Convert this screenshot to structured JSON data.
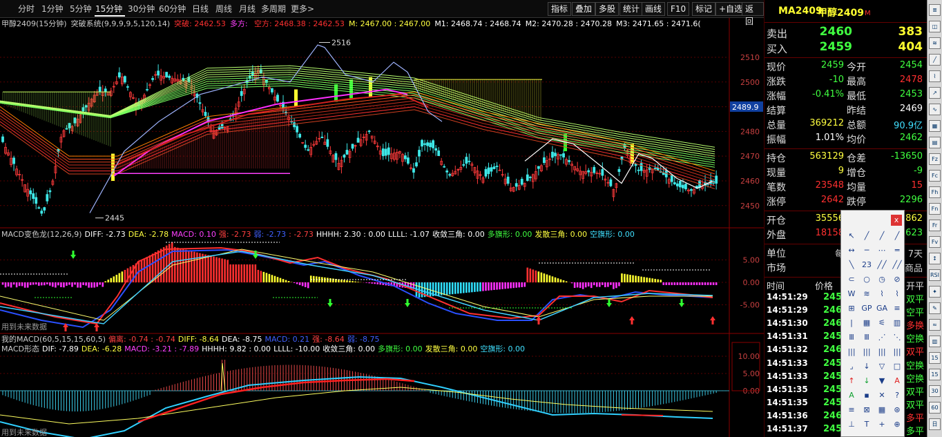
{
  "toolbar": {
    "periods": [
      "分时",
      "1分钟",
      "5分钟",
      "15分钟",
      "30分钟",
      "60分钟",
      "日线",
      "周线",
      "月线",
      "多周期",
      "更多>"
    ],
    "active_period": "15分钟",
    "right_buttons": [
      "指标",
      "叠加",
      "多股",
      "统计",
      "画线",
      "F10",
      "标记",
      "+自选",
      "返回"
    ]
  },
  "main_legend": {
    "symbol": "甲醇2409(15分钟)",
    "indicator": "突破系统(9,9,9,9,5,120,14)",
    "items": [
      {
        "text": "突破: 2462.53",
        "color": "#ff3030"
      },
      {
        "text": "多方: ",
        "color": "#ff40ff"
      },
      {
        "text": "空方: 2468.38 : 2462.53",
        "color": "#ff3030"
      },
      {
        "text": "M: 2467.00 : 2467.00",
        "color": "#ffff40"
      },
      {
        "text": "M1: 2468.74 : 2468.74",
        "color": "#ffffff"
      },
      {
        "text": "M2: 2470.28 : 2470.28",
        "color": "#ffffff"
      },
      {
        "text": "M3: 2471.65 : 2471.6(",
        "color": "#ffffff"
      }
    ]
  },
  "price_axis": [
    "2510",
    "2500",
    "2490",
    "2480",
    "2470",
    "2460",
    "2450"
  ],
  "current_price_tag": "2489.9",
  "annotations": {
    "high": "2516",
    "low": "2445"
  },
  "macd1": {
    "legend": "MACD变色龙(12,26,9)",
    "items": [
      {
        "text": "DIFF: -2.73",
        "color": "#ffffff"
      },
      {
        "text": "DEA: -2.78",
        "color": "#ffff40"
      },
      {
        "text": "MACD: 0.10",
        "color": "#ff40ff"
      },
      {
        "text": "强: -2.73",
        "color": "#ff4040"
      },
      {
        "text": "弱: -2.73",
        "color": "#4060ff"
      },
      {
        "text": ": -2.73",
        "color": "#ff4040"
      },
      {
        "text": "HHHH: 2.30 : 0.00",
        "color": "#ffffff"
      },
      {
        "text": "LLLL: -1.07",
        "color": "#ffffff"
      },
      {
        "text": "收敛三角: 0.00",
        "color": "#ffffff"
      },
      {
        "text": "多旗形: 0.00",
        "color": "#40ff40"
      },
      {
        "text": "发散三角: 0.00",
        "color": "#ffff40"
      },
      {
        "text": "空旗形: 0.00",
        "color": "#40e0ff"
      }
    ],
    "axis": [
      "5.00",
      "0.00",
      "-5.00"
    ]
  },
  "macd2": {
    "legend1": "我的MACD(60,5,15,15,60,5)",
    "items1": [
      {
        "text": "偏离: -0.74 : -0.74",
        "color": "#ff4040"
      },
      {
        "text": "DIFF: -8.64",
        "color": "#ffff40"
      },
      {
        "text": "DEA: -8.75",
        "color": "#ffffff"
      },
      {
        "text": "MACD: 0.21",
        "color": "#4060ff"
      },
      {
        "text": "强: -8.64",
        "color": "#ff4040"
      },
      {
        "text": "弱: -8.75",
        "color": "#4060ff"
      }
    ],
    "legend2": "MACD形态",
    "items2": [
      {
        "text": "DIF: -7.89",
        "color": "#ffffff"
      },
      {
        "text": "DEA: -6.28",
        "color": "#ffff40"
      },
      {
        "text": "MACD: -3.21 : -7.89",
        "color": "#ff40ff"
      },
      {
        "text": "HHHH: 9.82 : 0.00",
        "color": "#ffffff"
      },
      {
        "text": "LLLL: -10.00",
        "color": "#ffffff"
      },
      {
        "text": "收敛三角: 0.00",
        "color": "#ffffff"
      },
      {
        "text": "多旗形: 0.00",
        "color": "#40ff40"
      },
      {
        "text": "发散三角: 0.00",
        "color": "#ffff40"
      },
      {
        "text": "空旗形: 0.00",
        "color": "#40e0ff"
      }
    ],
    "axis": [
      "10.00",
      "5.00",
      "0.00"
    ]
  },
  "future_label": "用到未来数据",
  "quote": {
    "code": "MA2409",
    "name": "甲醇2409",
    "flag": "M",
    "sell": {
      "label": "卖出",
      "price": "2460",
      "vol": "383"
    },
    "buy": {
      "label": "买入",
      "price": "2459",
      "vol": "404"
    },
    "rows": [
      [
        {
          "l": "现价",
          "v": "2459",
          "c": "#40ff40"
        },
        {
          "l": "今开",
          "v": "2454",
          "c": "#40ff40"
        }
      ],
      [
        {
          "l": "涨跌",
          "v": "-10",
          "c": "#40ff40"
        },
        {
          "l": "最高",
          "v": "2478",
          "c": "#ff3030"
        }
      ],
      [
        {
          "l": "涨幅",
          "v": "-0.41%",
          "c": "#40ff40"
        },
        {
          "l": "最低",
          "v": "2453",
          "c": "#40ff40"
        }
      ],
      [
        {
          "l": "结算",
          "v": "",
          "c": "#fff"
        },
        {
          "l": "昨结",
          "v": "2469",
          "c": "#ffffff"
        }
      ],
      [
        {
          "l": "总量",
          "v": "369212",
          "c": "#ffff40"
        },
        {
          "l": "总额",
          "v": "90.9亿",
          "c": "#40e0ff"
        }
      ],
      [
        {
          "l": "振幅",
          "v": "1.01%",
          "c": "#ffffff"
        },
        {
          "l": "均价",
          "v": "2462",
          "c": "#40ff40"
        }
      ],
      [
        {
          "l": "持仓",
          "v": "563129",
          "c": "#ffff40"
        },
        {
          "l": "仓差",
          "v": "-13650",
          "c": "#40ff40"
        }
      ],
      [
        {
          "l": "现量",
          "v": "9",
          "c": "#ffff40"
        },
        {
          "l": "增仓",
          "v": "-9",
          "c": "#40ff40"
        }
      ],
      [
        {
          "l": "笔数",
          "v": "23548",
          "c": "#ff3030"
        },
        {
          "l": "均量",
          "v": "15",
          "c": "#ff3030"
        }
      ],
      [
        {
          "l": "涨停",
          "v": "2642",
          "c": "#ff3030"
        },
        {
          "l": "跌停",
          "v": "2296",
          "c": "#40ff40"
        }
      ],
      [
        {
          "l": "开仓",
          "v": "35556",
          "c": "#ffff40"
        },
        {
          "l": "",
          "v": "2862",
          "c": "#ffff40"
        }
      ],
      [
        {
          "l": "外盘",
          "v": "18158",
          "c": "#ff3030"
        },
        {
          "l": "",
          "v": "623",
          "c": "#40ff40"
        }
      ],
      [
        {
          "l": "单位",
          "v": "每",
          "c": "#ccc"
        },
        {
          "l": "",
          "v": "7天",
          "c": "#ccc"
        }
      ],
      [
        {
          "l": "市场",
          "v": "",
          "c": "#ccc"
        },
        {
          "l": "",
          "v": "商品",
          "c": "#ccc"
        }
      ]
    ],
    "trades_header": {
      "time": "时间",
      "price": "价格",
      "type": "开平"
    },
    "trades": [
      {
        "t": "14:51:29",
        "p": "245",
        "k": "双平",
        "c": "#40ff40"
      },
      {
        "t": "14:51:29",
        "p": "246",
        "k": "空平",
        "c": "#40ff40"
      },
      {
        "t": "14:51:30",
        "p": "246",
        "k": "多换",
        "c": "#ff3030"
      },
      {
        "t": "14:51:31",
        "p": "245",
        "k": "空换",
        "c": "#40ff40"
      },
      {
        "t": "14:51:32",
        "p": "246",
        "k": "双平",
        "c": "#ff3030"
      },
      {
        "t": "14:51:33",
        "p": "245",
        "k": "空换",
        "c": "#40ff40"
      },
      {
        "t": "14:51:33",
        "p": "245",
        "k": "空换",
        "c": "#40ff40"
      },
      {
        "t": "14:51:35",
        "p": "245",
        "k": "双平",
        "c": "#40ff40"
      },
      {
        "t": "14:51:35",
        "p": "245",
        "k": "双平",
        "c": "#40ff40"
      },
      {
        "t": "14:51:36",
        "p": "246",
        "k": "多平",
        "c": "#ff3030"
      },
      {
        "t": "14:51:37",
        "p": "245",
        "k": "多平",
        "c": "#40ff40"
      }
    ]
  },
  "draw_panel": {
    "close": "x",
    "tools": [
      "↖",
      "╱",
      "╱",
      "╱",
      "↔",
      "─",
      "⋯",
      "═",
      "╲",
      "23",
      "╱╱",
      "╱╱",
      "⊂",
      "○",
      "◷",
      "⊘",
      "W",
      "≋",
      "⌇",
      "⌇",
      "⊞",
      "GP",
      "GA",
      "≡",
      "|",
      "▦",
      "⚟",
      "▥",
      "Ⅲ",
      "Ⅲ",
      "⋰",
      "⋱",
      "|||",
      "|||",
      "|||",
      "|||",
      "⌟",
      "↓",
      "▽",
      "□",
      "↑",
      "↓",
      "▼",
      "A",
      "A",
      "▪",
      "✕",
      "?",
      "≡",
      "⊠",
      "▦",
      "⊛",
      "⊥",
      "T",
      "+",
      "⊕"
    ]
  },
  "sidebar_icons": [
    "≣",
    "◫",
    "≋",
    "╱",
    "⌇",
    "↗",
    "∿",
    "▦",
    "▤",
    "Fz",
    "Fc",
    "Fh",
    "Fn",
    "Fr",
    "Fv",
    "↕",
    "RSI",
    "✦",
    "✎",
    "≈",
    "▥",
    "15",
    "15",
    "30",
    "60",
    "日"
  ]
}
